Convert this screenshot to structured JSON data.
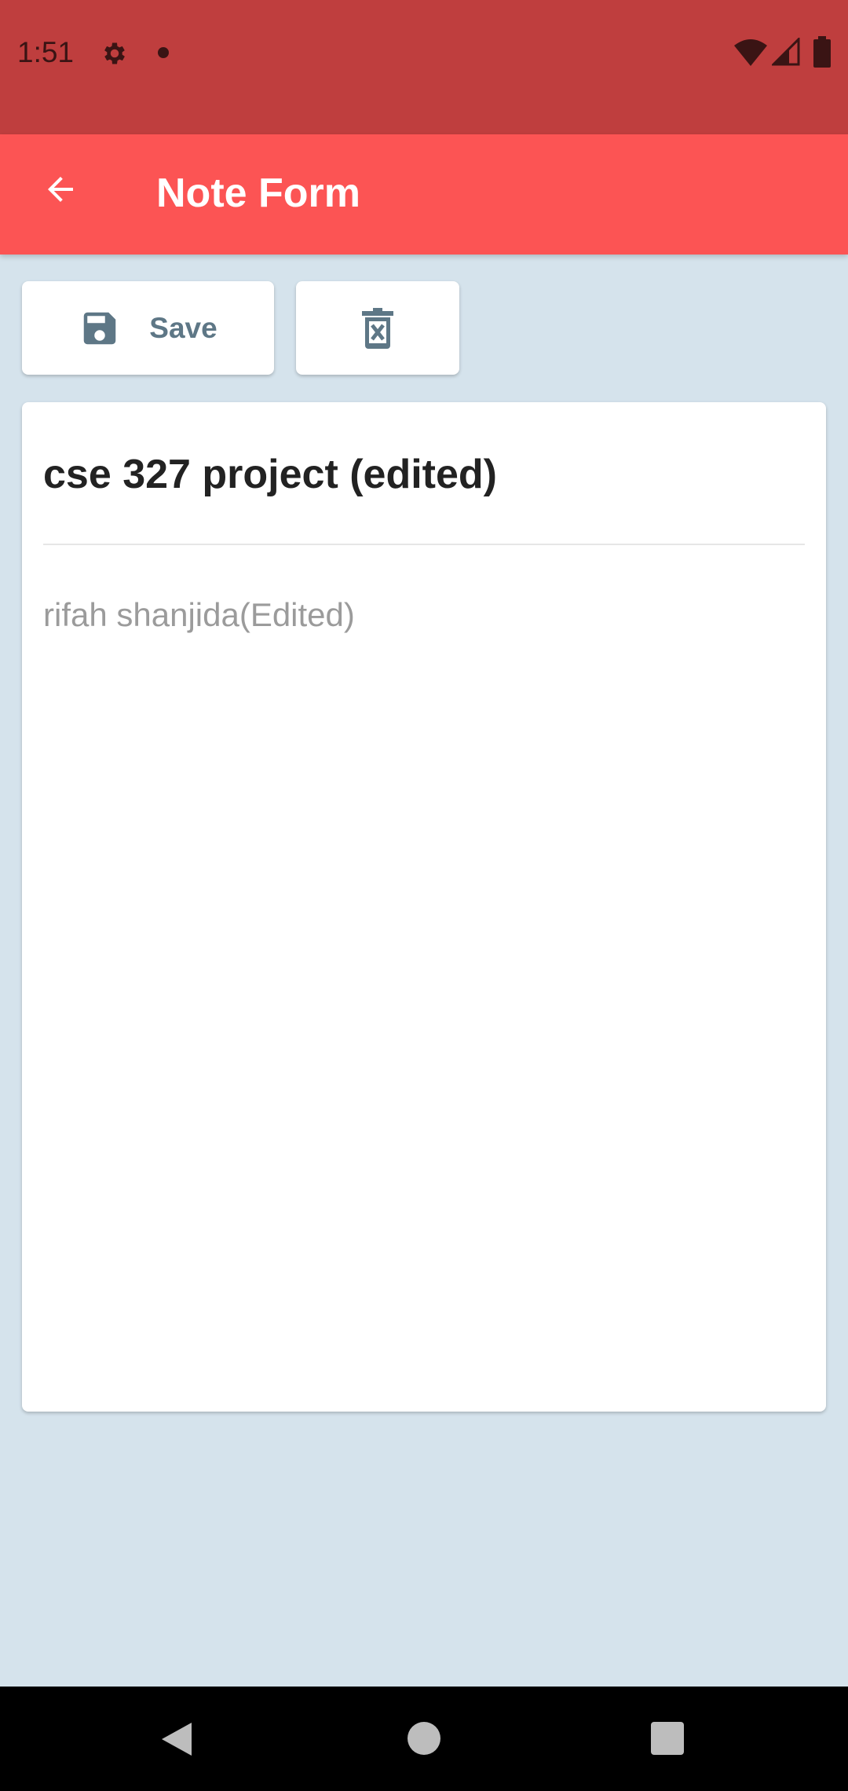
{
  "status_bar": {
    "time": "1:51",
    "icons": [
      "gear-icon",
      "notification-dot-icon",
      "wifi-icon",
      "cell-signal-icon",
      "battery-icon"
    ]
  },
  "app_bar": {
    "title": "Note Form",
    "back_icon": "arrow-left-icon",
    "color": "#fc5454"
  },
  "toolbar": {
    "save_label": "Save",
    "save_icon": "floppy-disk-icon",
    "delete_icon": "trash-x-icon"
  },
  "note": {
    "title": "cse 327 project (edited)",
    "body": "rifah shanjida(Edited)"
  },
  "nav_bar": {
    "icons": [
      "nav-back-icon",
      "nav-home-icon",
      "nav-recents-icon"
    ]
  },
  "colors": {
    "status_bar": "#bf3e3e",
    "background": "#d5e3ec",
    "icon_slate": "#5e7786"
  }
}
